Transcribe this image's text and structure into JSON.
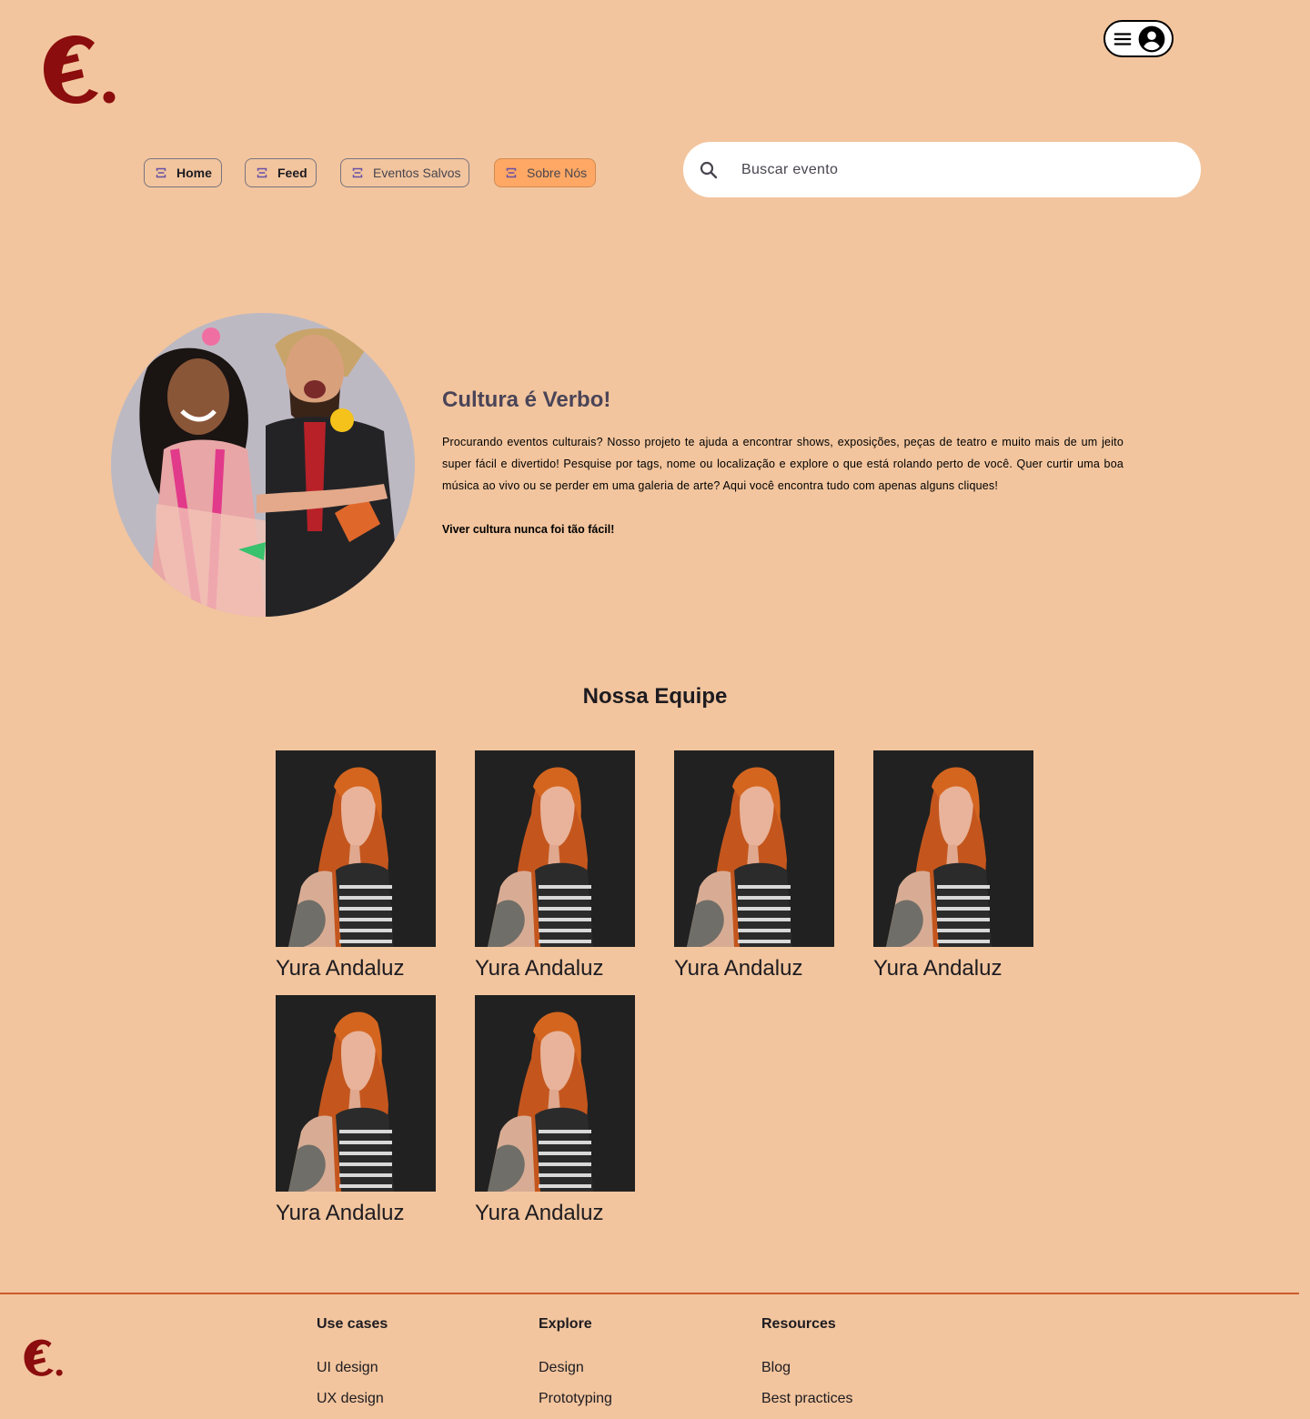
{
  "header": {
    "logo_alt": "E.",
    "menu_icon": "hamburger-menu-icon",
    "profile_icon": "account-circle-icon"
  },
  "nav": {
    "chip_icon": "ticket-icon",
    "items": [
      {
        "label": "Home"
      },
      {
        "label": "Feed"
      },
      {
        "label": "Eventos Salvos"
      },
      {
        "label": "Sobre Nós"
      }
    ],
    "active": "Sobre Nós"
  },
  "search": {
    "placeholder": "Buscar evento",
    "icon": "search-icon"
  },
  "hero": {
    "title": "Cultura é Verbo!",
    "body": "Procurando eventos culturais? Nosso projeto te ajuda a encontrar shows, exposições, peças de teatro e muito mais de um jeito super fácil e divertido! Pesquise por tags, nome ou localização e explore o que está rolando perto de você. Quer curtir uma boa música ao vivo ou se perder em uma galeria de arte? Aqui você encontra tudo com apenas alguns cliques!",
    "tagline": "Viver cultura nunca foi tão fácil!"
  },
  "team": {
    "title": "Nossa Equipe",
    "members": [
      {
        "name": "Yura Andaluz"
      },
      {
        "name": "Yura Andaluz"
      },
      {
        "name": "Yura Andaluz"
      },
      {
        "name": "Yura Andaluz"
      },
      {
        "name": "Yura Andaluz"
      },
      {
        "name": "Yura Andaluz"
      }
    ]
  },
  "footer": {
    "columns": [
      {
        "heading": "Use cases",
        "links": [
          "UI design",
          "UX design"
        ]
      },
      {
        "heading": "Explore",
        "links": [
          "Design",
          "Prototyping"
        ]
      },
      {
        "heading": "Resources",
        "links": [
          "Blog",
          "Best practices"
        ]
      }
    ]
  },
  "colors": {
    "background": "#f2c59e",
    "brand": "#8b0d0d",
    "active_chip": "#ffa865",
    "footer_rule": "#cc5c2a"
  }
}
